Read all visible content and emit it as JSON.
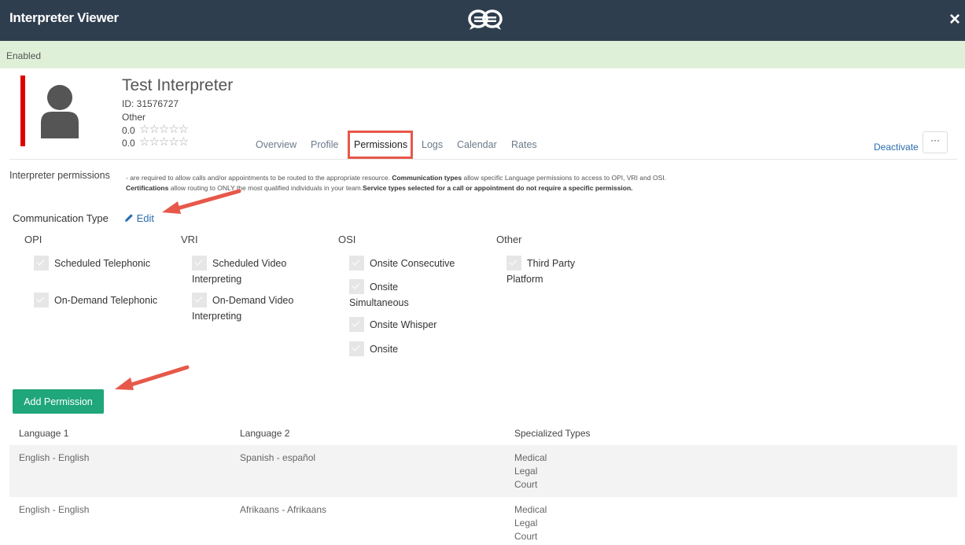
{
  "header": {
    "title": "Interpreter Viewer",
    "close_icon": "×"
  },
  "status": "Enabled",
  "profile": {
    "name": "Test Interpreter",
    "id": "ID: 31576727",
    "category": "Other",
    "rating1": "0.0",
    "rating2": "0.0",
    "stars": "☆☆☆☆☆"
  },
  "tabs": [
    "Overview",
    "Profile",
    "Permissions",
    "Logs",
    "Calendar",
    "Rates"
  ],
  "active_tab": "Permissions",
  "actions": {
    "deactivate": "Deactivate",
    "more": "···"
  },
  "permissions": {
    "title": "Interpreter permissions",
    "desc_parts": [
      " - are required to allow calls and/or appointments to be routed to the appropriate resource. ",
      "Communication types",
      " allow specific Language permissions to access to OPI, VRI and OSI.",
      "Certifications",
      " allow routing to ONLY the most qualified individuals in your team.",
      "Service types selected for a call or appointment do not require a specific permission."
    ]
  },
  "communication": {
    "label": "Communication Type",
    "edit": "Edit",
    "groups": [
      {
        "name": "OPI",
        "items": [
          "Scheduled Telephonic",
          "On-Demand Telephonic"
        ]
      },
      {
        "name": "VRI",
        "items": [
          "Scheduled Video Interpreting",
          "On-Demand Video Interpreting"
        ]
      },
      {
        "name": "OSI",
        "items": [
          "Onsite Consecutive",
          "Onsite Simultaneous",
          "Onsite Whisper",
          "Onsite"
        ]
      },
      {
        "name": "Other",
        "items": [
          "Third Party Platform"
        ]
      }
    ]
  },
  "add_permission": "Add Permission",
  "table": {
    "headers": [
      "Language 1",
      "Language 2",
      "Specialized Types"
    ],
    "rows": [
      {
        "lang1": "English - English",
        "lang2": "Spanish - español",
        "types": [
          "Medical",
          "Legal",
          "Court"
        ]
      },
      {
        "lang1": "English - English",
        "lang2": "Afrikaans - Afrikaans",
        "types": [
          "Medical",
          "Legal",
          "Court"
        ]
      }
    ]
  },
  "colors": {
    "header_bg": "#2f3e4f",
    "status_bg": "#dff0d8",
    "accent_red": "#e00000",
    "annotation": "#e7584a",
    "button_green": "#1fa67a",
    "link_blue": "#2a6db0"
  },
  "icons": {
    "logo": "chat-bubbles-logo",
    "close": "close-icon",
    "avatar": "user-avatar-icon",
    "edit": "pencil-icon",
    "checkbox": "checkmark-icon"
  }
}
